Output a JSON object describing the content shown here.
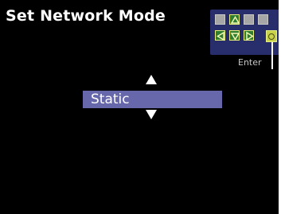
{
  "screen": {
    "title": "Set Network Mode"
  },
  "selector": {
    "selected_value": "Static"
  },
  "keypad": {
    "enter_label": "Enter",
    "keys_row1": [
      "blank",
      "up-arrow",
      "blank",
      "blank"
    ],
    "keys_row2": [
      "left-arrow",
      "down-arrow",
      "right-arrow",
      "enter"
    ]
  },
  "colors": {
    "background": "#000000",
    "title_text": "#ffffff",
    "selection_bar": "#6767ab",
    "keypad_panel": "#282d6b",
    "key_gray": "#a6a6a6",
    "key_green": "#2e7d32",
    "key_outline": "#e6f07a",
    "enter_key": "#c9d34a"
  }
}
